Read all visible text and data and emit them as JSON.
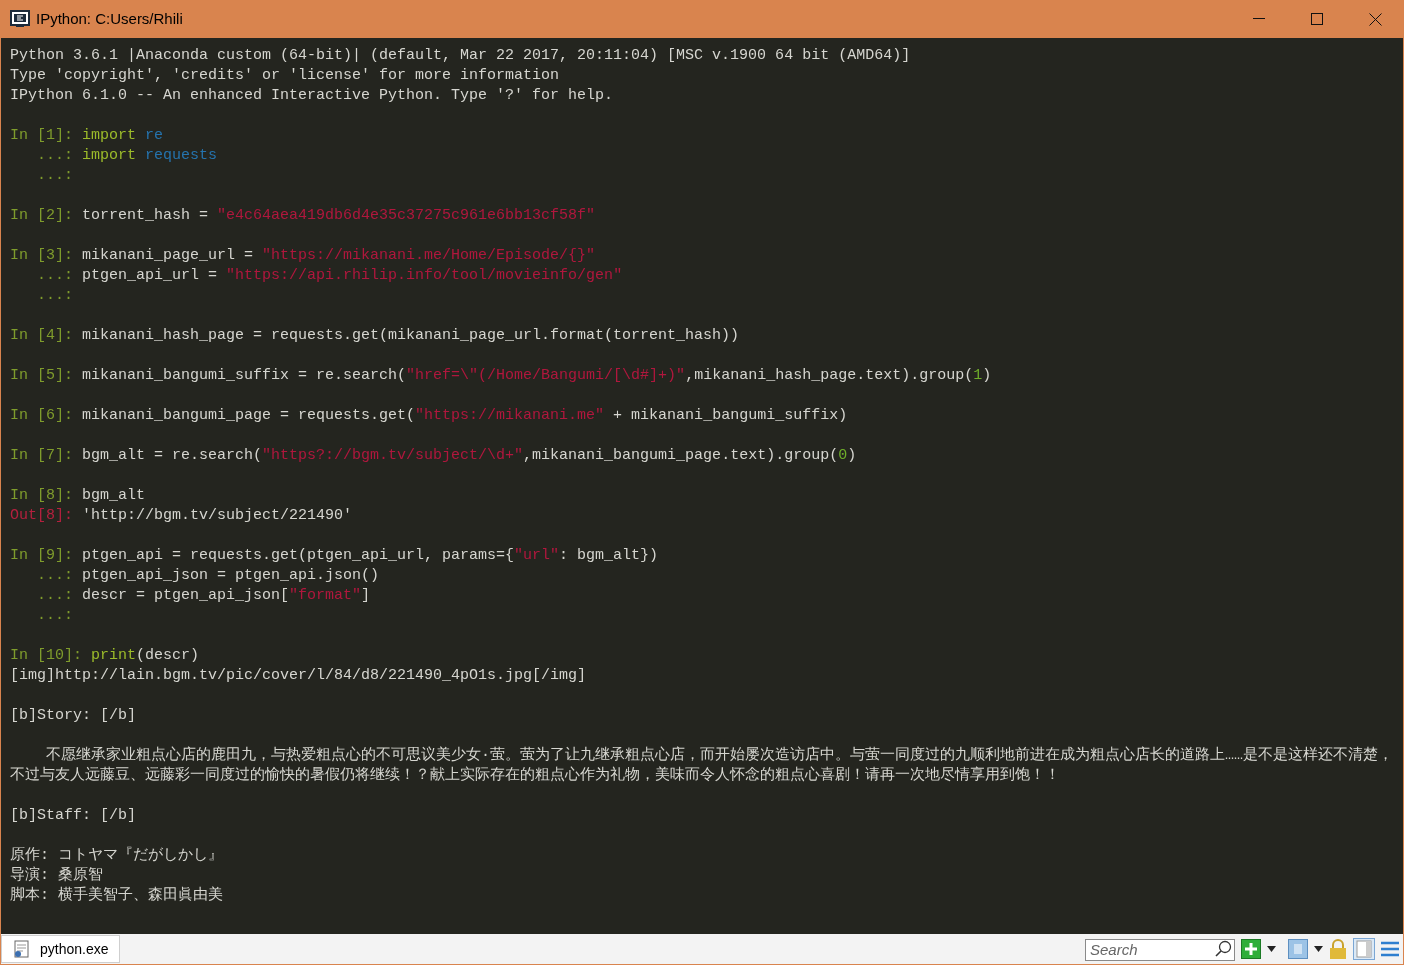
{
  "window": {
    "title": "IPython: C:Users/Rhili"
  },
  "blocks": [
    {
      "lines": [
        [
          {
            "kind": "plain",
            "text": "Python 3.6.1 |Anaconda custom (64-bit)| (default, Mar 22 2017, 20:11:04) [MSC v.1900 64 bit (AMD64)]"
          }
        ],
        [
          {
            "kind": "plain",
            "text": "Type 'copyright', 'credits' or 'license' for more information"
          }
        ],
        [
          {
            "kind": "plain",
            "text": "IPython 6.1.0 -- An enhanced Interactive Python. Type '?' for help."
          }
        ]
      ]
    },
    {
      "lines": [
        [
          {
            "kind": "prompt",
            "text": "In [1]: "
          },
          {
            "kind": "keyword",
            "text": "import "
          },
          {
            "kind": "module",
            "text": "re"
          }
        ],
        [
          {
            "kind": "prompt",
            "text": "   ...: "
          },
          {
            "kind": "keyword",
            "text": "import "
          },
          {
            "kind": "module",
            "text": "requests"
          }
        ],
        [
          {
            "kind": "prompt",
            "text": "   ...:"
          }
        ]
      ]
    },
    {
      "lines": [
        [
          {
            "kind": "prompt",
            "text": "In [2]: "
          },
          {
            "kind": "plain",
            "text": "torrent_hash = "
          },
          {
            "kind": "string",
            "text": "\"e4c64aea419db6d4e35c37275c961e6bb13cf58f\""
          }
        ]
      ]
    },
    {
      "lines": [
        [
          {
            "kind": "prompt",
            "text": "In [3]: "
          },
          {
            "kind": "plain",
            "text": "mikanani_page_url = "
          },
          {
            "kind": "string",
            "text": "\"https://mikanani.me/Home/Episode/{}\""
          }
        ],
        [
          {
            "kind": "prompt",
            "text": "   ...: "
          },
          {
            "kind": "plain",
            "text": "ptgen_api_url = "
          },
          {
            "kind": "string",
            "text": "\"https://api.rhilip.info/tool/movieinfo/gen\""
          }
        ],
        [
          {
            "kind": "prompt",
            "text": "   ...:"
          }
        ]
      ]
    },
    {
      "lines": [
        [
          {
            "kind": "prompt",
            "text": "In [4]: "
          },
          {
            "kind": "plain",
            "text": "mikanani_hash_page = requests.get(mikanani_page_url.format(torrent_hash))"
          }
        ]
      ]
    },
    {
      "lines": [
        [
          {
            "kind": "prompt",
            "text": "In [5]: "
          },
          {
            "kind": "plain",
            "text": "mikanani_bangumi_suffix = re.search("
          },
          {
            "kind": "string",
            "text": "\"href=\\\"(/Home/Bangumi/[\\d#]+)\""
          },
          {
            "kind": "plain",
            "text": ",mikanani_hash_page.text).group("
          },
          {
            "kind": "number",
            "text": "1"
          },
          {
            "kind": "plain",
            "text": ")"
          }
        ]
      ]
    },
    {
      "lines": [
        [
          {
            "kind": "prompt",
            "text": "In [6]: "
          },
          {
            "kind": "plain",
            "text": "mikanani_bangumi_page = requests.get("
          },
          {
            "kind": "string",
            "text": "\"https://mikanani.me\""
          },
          {
            "kind": "plain",
            "text": " + mikanani_bangumi_suffix)"
          }
        ]
      ]
    },
    {
      "lines": [
        [
          {
            "kind": "prompt",
            "text": "In [7]: "
          },
          {
            "kind": "plain",
            "text": "bgm_alt = re.search("
          },
          {
            "kind": "string",
            "text": "\"https?://bgm.tv/subject/\\d+\""
          },
          {
            "kind": "plain",
            "text": ",mikanani_bangumi_page.text).group("
          },
          {
            "kind": "number",
            "text": "0"
          },
          {
            "kind": "plain",
            "text": ")"
          }
        ]
      ]
    },
    {
      "lines": [
        [
          {
            "kind": "prompt",
            "text": "In [8]: "
          },
          {
            "kind": "plain",
            "text": "bgm_alt"
          }
        ],
        [
          {
            "kind": "out",
            "text": "Out[8]: "
          },
          {
            "kind": "plain",
            "text": "'http://bgm.tv/subject/221490'"
          }
        ]
      ]
    },
    {
      "lines": [
        [
          {
            "kind": "prompt",
            "text": "In [9]: "
          },
          {
            "kind": "plain",
            "text": "ptgen_api = requests.get(ptgen_api_url, params={"
          },
          {
            "kind": "string",
            "text": "\"url\""
          },
          {
            "kind": "plain",
            "text": ": bgm_alt})"
          }
        ],
        [
          {
            "kind": "prompt",
            "text": "   ...: "
          },
          {
            "kind": "plain",
            "text": "ptgen_api_json = ptgen_api.json()"
          }
        ],
        [
          {
            "kind": "prompt",
            "text": "   ...: "
          },
          {
            "kind": "plain",
            "text": "descr = ptgen_api_json["
          },
          {
            "kind": "string",
            "text": "\"format\""
          },
          {
            "kind": "plain",
            "text": "]"
          }
        ],
        [
          {
            "kind": "prompt",
            "text": "   ...:"
          }
        ]
      ]
    },
    {
      "lines": [
        [
          {
            "kind": "prompt",
            "text": "In [10]: "
          },
          {
            "kind": "keyword",
            "text": "print"
          },
          {
            "kind": "plain",
            "text": "(descr)"
          }
        ],
        [
          {
            "kind": "plain",
            "text": "[img]http://lain.bgm.tv/pic/cover/l/84/d8/221490_4pO1s.jpg[/img]"
          }
        ]
      ]
    },
    {
      "lines": [
        [
          {
            "kind": "plain",
            "text": "[b]Story: [/b]"
          }
        ]
      ]
    },
    {
      "lines": [
        [
          {
            "kind": "plain",
            "text": "    不愿继承家业粗点心店的鹿田九，与热爱粗点心的不可思议美少女·萤。萤为了让九继承粗点心店，而开始屡次造访店中。与萤一同度过的九顺利地前进在成为粗点心店长的道路上……是不是这样还不清楚，不过与友人远藤豆、远藤彩一同度过的愉快的暑假仍将继续！？献上实际存在的粗点心作为礼物，美味而令人怀念的粗点心喜剧！请再一次地尽情享用到饱！！"
          }
        ]
      ]
    },
    {
      "lines": [
        [
          {
            "kind": "plain",
            "text": "[b]Staff: [/b]"
          }
        ]
      ]
    },
    {
      "lines": [
        [
          {
            "kind": "plain",
            "text": "原作: コトヤマ『だがしかし』"
          }
        ],
        [
          {
            "kind": "plain",
            "text": "导演: 桑原智"
          }
        ],
        [
          {
            "kind": "plain",
            "text": "脚本: 横手美智子、森田眞由美"
          }
        ]
      ]
    }
  ],
  "status_bar": {
    "tab": "python.exe",
    "search": {
      "placeholder": "Search"
    }
  }
}
